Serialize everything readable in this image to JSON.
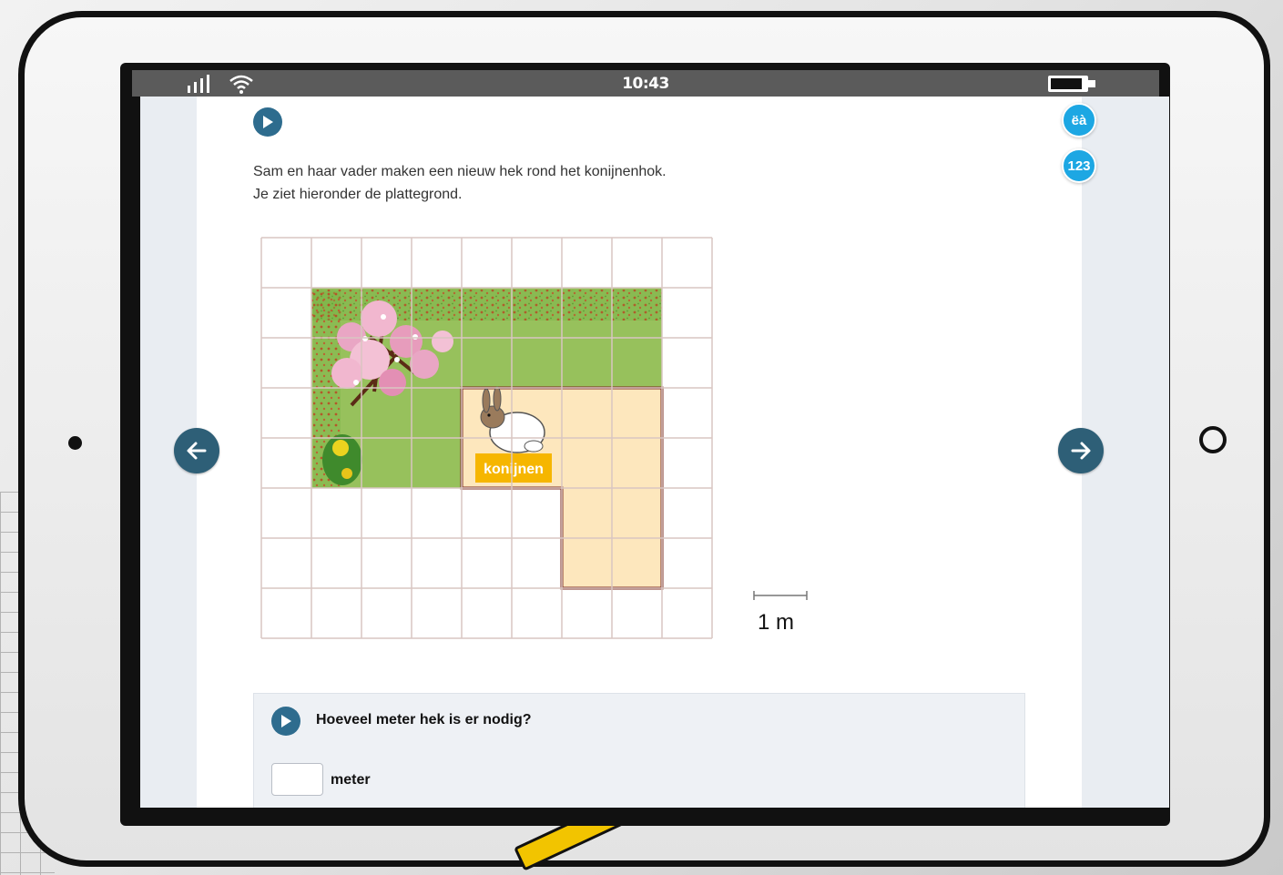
{
  "status_bar": {
    "time": "10:43"
  },
  "tools": {
    "language_label": "ëà",
    "numbers_label": "123"
  },
  "exercise": {
    "intro_line1": "Sam en haar vader maken een nieuw hek rond het konijnenhok.",
    "intro_line2": "Je ziet hieronder de plattegrond.",
    "map_label": "konijnen",
    "scale_label": "1 m",
    "question": "Hoeveel meter hek is er nodig?",
    "answer_value": "",
    "answer_unit": "meter"
  },
  "icons": {
    "audio": "play-icon",
    "prev": "arrow-left-icon",
    "next": "arrow-right-icon",
    "signal": "signal-bars-icon",
    "wifi": "wifi-icon",
    "battery": "battery-icon"
  },
  "colors": {
    "status_bar": "#5b5b5b",
    "audio_button": "#2e6c8e",
    "nav_arrow": "#2e5f77",
    "tool_button": "#1da7e3",
    "lawn": "#97c15c",
    "hutch": "#fde7bd",
    "hutch_border": "#7b2a1f",
    "label_bg": "#f6b600"
  }
}
